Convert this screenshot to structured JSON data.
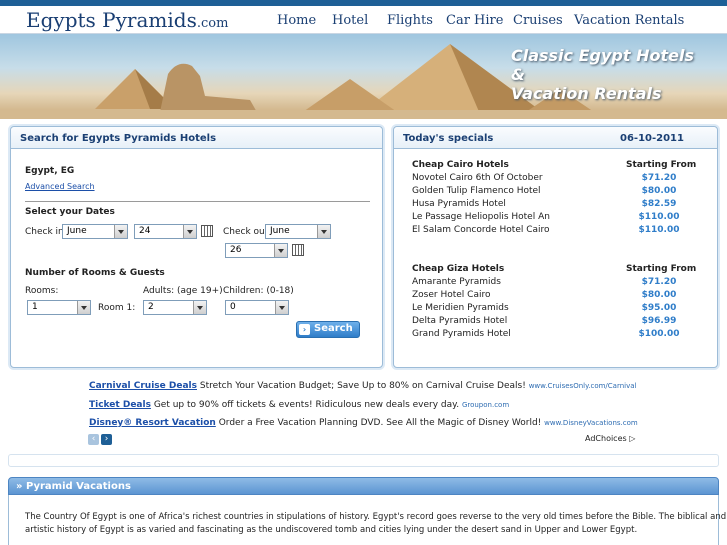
{
  "site": {
    "logo_main": "Egypts Pyramids",
    "logo_domain": ".com"
  },
  "nav": [
    "Home",
    "Hotel",
    "Flights",
    "Car Hire",
    "Cruises",
    "Vacation Rentals"
  ],
  "banner": {
    "tagline_line1": "Classic Egypt Hotels &",
    "tagline_line2": "Vacation Rentals"
  },
  "search": {
    "title": "Search for Egypts Pyramids Hotels",
    "location": "Egypt, EG",
    "advanced": "Advanced Search",
    "dates_label": "Select your Dates",
    "checkin_label": "Check in",
    "checkin_month": "June",
    "checkin_day": "24",
    "checkout_label": "Check out",
    "checkout_month": "June",
    "checkout_day": "26",
    "rooms_title": "Number of Rooms & Guests",
    "rooms_label": "Rooms:",
    "adults_label": "Adults: (age 19+)",
    "children_label": "Children: (0-18)",
    "rooms_value": "1",
    "room1_label": "Room 1:",
    "adults_value": "2",
    "children_value": "0",
    "button": "Search"
  },
  "specials": {
    "title": "Today's specials",
    "date": "06-10-2011",
    "groups": [
      {
        "heading": "Cheap Cairo Hotels",
        "from_label": "Starting From",
        "hotels": [
          {
            "name": "Novotel Cairo 6th Of October",
            "price": "$71.20"
          },
          {
            "name": "Golden Tulip Flamenco Hotel",
            "price": "$80.00"
          },
          {
            "name": "Husa Pyramids Hotel",
            "price": "$82.59"
          },
          {
            "name": "Le Passage Heliopolis Hotel An",
            "price": "$110.00"
          },
          {
            "name": "El Salam Concorde Hotel Cairo",
            "price": "$110.00"
          }
        ]
      },
      {
        "heading": "Cheap Giza Hotels",
        "from_label": "Starting From",
        "hotels": [
          {
            "name": "Amarante Pyramids",
            "price": "$71.20"
          },
          {
            "name": "Zoser Hotel Cairo",
            "price": "$80.00"
          },
          {
            "name": "Le Meridien Pyramids",
            "price": "$95.00"
          },
          {
            "name": "Delta Pyramids Hotel",
            "price": "$96.99"
          },
          {
            "name": "Grand Pyramids Hotel",
            "price": "$100.00"
          }
        ]
      }
    ]
  },
  "ads": [
    {
      "headline": "Carnival Cruise Deals",
      "text": "Stretch Your Vacation Budget; Save Up to 80% on Carnival Cruise Deals!",
      "url": "www.CruisesOnly.com/Carnival"
    },
    {
      "headline": "Ticket Deals",
      "text": "Get up to 90% off tickets & events! Ridiculous new deals every day.",
      "url": "Groupon.com"
    },
    {
      "headline": "Disney® Resort Vacation",
      "text": "Order a Free Vacation Planning DVD. See All the Magic of Disney World!",
      "url": "www.DisneyVacations.com"
    }
  ],
  "adchoices": "AdChoices",
  "vacations": {
    "title": "Pyramid Vacations",
    "line1": "The Country Of Egypt is one of Africa's richest countries in stipulations of history. Egypt's record goes reverse to the very old times before the Bible. The biblical and",
    "line2": "artistic history of Egypt is as varied and fascinating as the undiscovered tomb and cities lying under the desert sand in Upper and Lower Egypt."
  },
  "colors": {
    "brand": "#1a3f73",
    "accent": "#2f7dc9",
    "link": "#1c4fa8"
  }
}
